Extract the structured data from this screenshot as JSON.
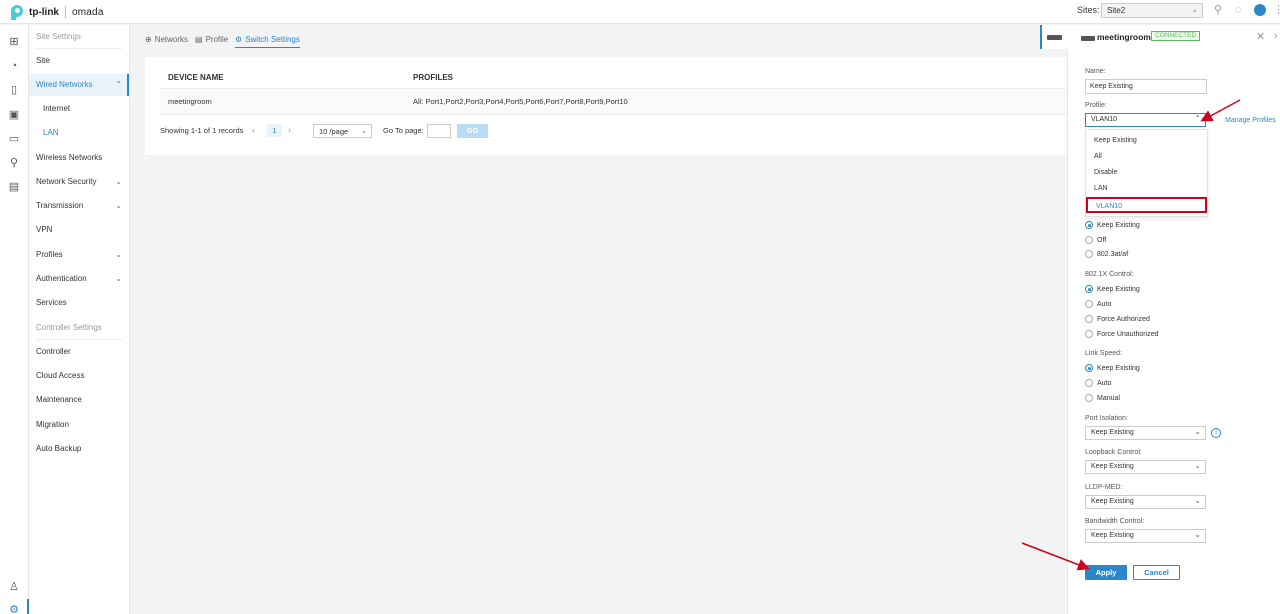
{
  "brand": {
    "logo_text": "tp-link",
    "product": "omada"
  },
  "topbar": {
    "sites_label": "Sites:",
    "site_value": "Site2",
    "icons": [
      "search-icon",
      "refresh-icon",
      "avatar",
      "more-icon"
    ]
  },
  "rail_icons": [
    "dashboard-icon",
    "statistics-icon",
    "map-icon",
    "devices-icon",
    "clients-icon",
    "insight-icon",
    "logs-icon",
    "account-icon",
    "settings-icon"
  ],
  "sidebar": {
    "site_settings_header": "Site Settings",
    "site": "Site",
    "wired_networks": "Wired Networks",
    "internet": "Internet",
    "lan": "LAN",
    "wireless_networks": "Wireless Networks",
    "network_security": "Network Security",
    "transmission": "Transmission",
    "vpn": "VPN",
    "profiles": "Profiles",
    "authentication": "Authentication",
    "services": "Services",
    "controller_settings_header": "Controller Settings",
    "controller": "Controller",
    "cloud_access": "Cloud Access",
    "maintenance": "Maintenance",
    "migration": "Migration",
    "auto_backup": "Auto Backup"
  },
  "tabs": {
    "networks": "Networks",
    "profile": "Profile",
    "switch_settings": "Switch Settings"
  },
  "table": {
    "headers": {
      "device_name": "DEVICE NAME",
      "profiles": "PROFILES"
    },
    "rows": [
      {
        "device_name": "meetingroom",
        "profiles": "All: Port1,Port2,Port3,Port4,Port5,Port6,Port7,Port8,Port9,Port10"
      }
    ]
  },
  "pager": {
    "summary": "Showing 1-1 of 1 records",
    "current_page": "1",
    "page_size": "10 /page",
    "goto_label": "Go To page:",
    "go_button": "GO"
  },
  "device": {
    "name": "meetingroom",
    "status": "CONNECTED"
  },
  "form": {
    "name_label": "Name:",
    "name_value": "Keep Existing",
    "profile_label": "Profile:",
    "profile_value": "VLAN10",
    "manage_profiles": "Manage Profiles",
    "profile_options": [
      "Keep Existing",
      "All",
      "Disable",
      "LAN",
      "VLAN10"
    ],
    "poe_options": [
      "Keep Existing",
      "Off",
      "802.3at/af"
    ],
    "dot1x_label": "802.1X Control:",
    "dot1x_options": [
      "Keep Existing",
      "Auto",
      "Force Authorized",
      "Force Unauthorized"
    ],
    "link_speed_label": "Link Speed:",
    "link_speed_options": [
      "Keep Existing",
      "Auto",
      "Manual"
    ],
    "port_isolation_label": "Port Isolation:",
    "port_isolation_value": "Keep Existing",
    "loopback_label": "Loopback Control:",
    "loopback_value": "Keep Existing",
    "lldp_label": "LLDP-MED:",
    "lldp_value": "Keep Existing",
    "bandwidth_label": "Bandwidth Control:",
    "bandwidth_value": "Keep Existing",
    "apply": "Apply",
    "cancel": "Cancel"
  },
  "colors": {
    "accent": "#2b87c8",
    "annotation": "#d0021b",
    "connected": "#5cb85c"
  }
}
